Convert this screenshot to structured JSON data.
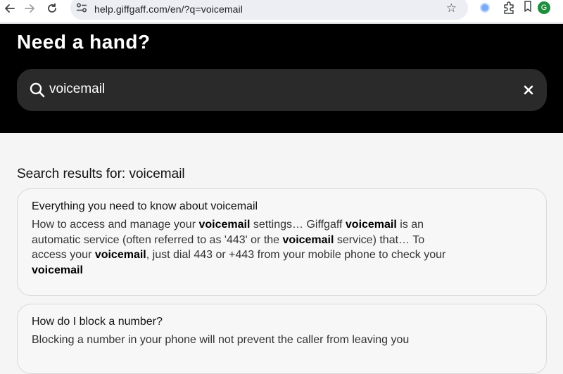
{
  "browser": {
    "url": "help.giffgaff.com/en/?q=voicemail",
    "profile_initial": "G"
  },
  "hero": {
    "title": "Need a hand?",
    "search_value": "voicemail"
  },
  "results": {
    "heading": "Search results for: voicemail",
    "items": [
      {
        "title": "Everything you need to know about voicemail",
        "snippet": [
          {
            "t": "How to access and manage your ",
            "b": false
          },
          {
            "t": "voicemail",
            "b": true
          },
          {
            "t": " settings… Giffgaff ",
            "b": false
          },
          {
            "t": "voicemail",
            "b": true
          },
          {
            "t": " is an automatic service (often referred to as '443' or the ",
            "b": false
          },
          {
            "t": "voicemail",
            "b": true
          },
          {
            "t": " service) that… To access your ",
            "b": false
          },
          {
            "t": "voicemail",
            "b": true
          },
          {
            "t": ", just dial 443 or +443 from your mobile phone to check your ",
            "b": false
          },
          {
            "t": "voicemail",
            "b": true
          }
        ]
      },
      {
        "title": "How do I block a number?",
        "snippet": [
          {
            "t": "Blocking a number in your phone will not prevent the caller from leaving you",
            "b": false
          }
        ]
      }
    ]
  }
}
